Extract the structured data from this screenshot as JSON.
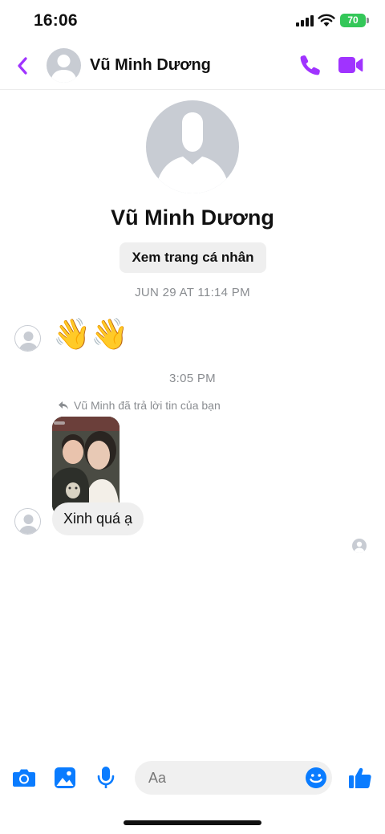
{
  "status_bar": {
    "time": "16:06",
    "battery": "70"
  },
  "header": {
    "contact_name": "Vũ Minh Dương",
    "icons": [
      "chevron-left-icon",
      "phone-icon",
      "video-camera-icon"
    ]
  },
  "profile": {
    "name": "Vũ Minh Dương",
    "view_profile_label": "Xem trang cá nhân"
  },
  "conversation": {
    "timestamp_1": "JUN 29 AT 11:14 PM",
    "wave_emojis": "👋👋",
    "timestamp_2": "3:05 PM",
    "reply_note": "Vũ Minh đã trả lời tin của bạn",
    "reply_text": "Xinh quá ạ"
  },
  "composer": {
    "placeholder": "Aa",
    "icons": [
      "camera-icon",
      "image-icon",
      "microphone-icon",
      "emoji-icon",
      "thumbs-up-icon"
    ]
  },
  "colors": {
    "accent_purple": "#a033ff",
    "accent_blue": "#0a7cff",
    "battery_green": "#34c759",
    "bubble_gray": "#efefef",
    "meta_gray": "#8a8d91"
  }
}
